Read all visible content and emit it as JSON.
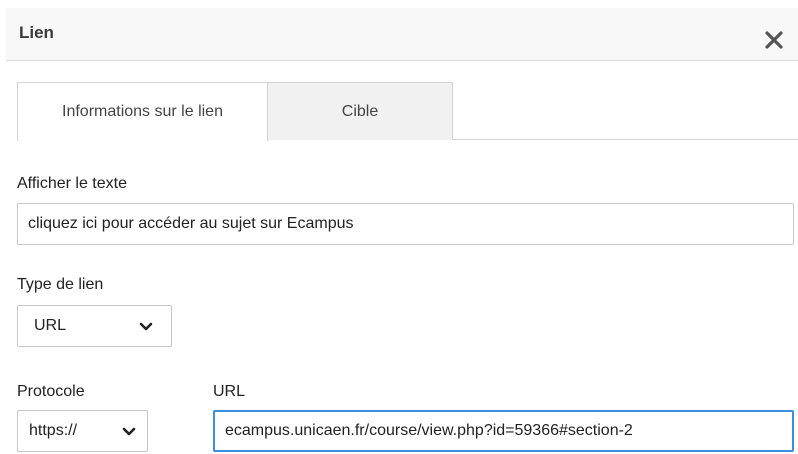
{
  "dialog": {
    "title": "Lien",
    "close_icon": "close-icon"
  },
  "tabs": [
    {
      "label": "Informations sur le lien",
      "active": true
    },
    {
      "label": "Cible",
      "active": false
    }
  ],
  "form": {
    "display_text": {
      "label": "Afficher le texte",
      "value": "cliquez ici pour accéder au sujet sur Ecampus"
    },
    "link_type": {
      "label": "Type de lien",
      "selected": "URL"
    },
    "protocol": {
      "label": "Protocole",
      "selected": "https://"
    },
    "url": {
      "label": "URL",
      "value": "ecampus.unicaen.fr/course/view.php?id=59366#section-2"
    }
  },
  "colors": {
    "focus_border": "#3a8ee6",
    "inactive_tab_bg": "#f1f1f1",
    "titlebar_bg": "#f8f8f8"
  }
}
